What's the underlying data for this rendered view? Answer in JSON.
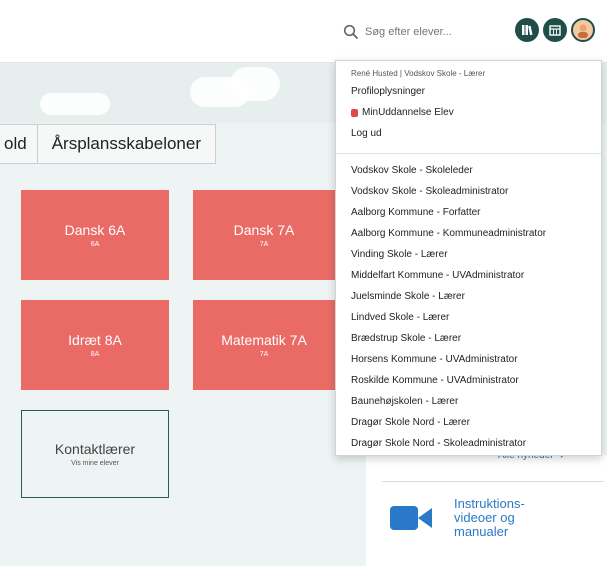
{
  "header": {
    "search_placeholder": "Søg efter elever..."
  },
  "icons": [
    "search-icon",
    "library-icon",
    "calendar-icon",
    "avatar-icon",
    "video-icon"
  ],
  "tabs": [
    {
      "label": "old"
    },
    {
      "label": "Årsplansskabeloner"
    }
  ],
  "tiles": [
    {
      "title": "Dansk 6A",
      "sub": "6A"
    },
    {
      "title": "Dansk 7A",
      "sub": "7A"
    },
    {
      "title": "Idræt 8A",
      "sub": "8A"
    },
    {
      "title": "Matematik 7A",
      "sub": "7A"
    },
    {
      "title": "Kontaktlærer",
      "sub": "Vis mine elever"
    }
  ],
  "colors": {
    "tile_red": "#ea6b66",
    "dark_teal": "#1f4d4a",
    "link_blue": "#2a79c8"
  },
  "dropdown": {
    "header": "René Husted | Vodskov Skole - Lærer",
    "links": [
      "Profiloplysninger",
      "MinUddannelse Elev",
      "Log ud"
    ],
    "roles": [
      "Vodskov Skole - Skoleleder",
      "Vodskov Skole - Skoleadministrator",
      "Aalborg Kommune - Forfatter",
      "Aalborg Kommune - Kommuneadministrator",
      "Vinding Skole - Lærer",
      "Middelfart Kommune - UVAdministrator",
      "Juelsminde Skole - Lærer",
      "Lindved Skole - Lærer",
      "Brædstrup Skole - Lærer",
      "Horsens Kommune - UVAdministrator",
      "Roskilde Kommune - UVAdministrator",
      "Baunehøjskolen - Lærer",
      "Dragør Skole Nord - Lærer",
      "Dragør Skole Nord - Skoleadministrator"
    ]
  },
  "news": {
    "all_news": "Alle nyheder ➔"
  },
  "resources": {
    "video_label": "Instruktions-videoer og manualer"
  }
}
